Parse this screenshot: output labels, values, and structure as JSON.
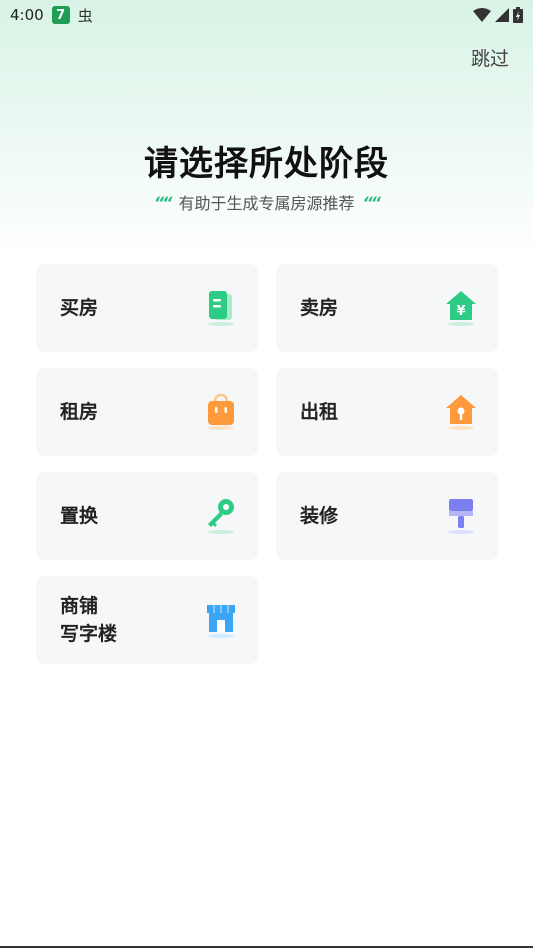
{
  "status_bar": {
    "time": "4:00",
    "app_badge": "7",
    "bug_glyph": "虫"
  },
  "header": {
    "skip_label": "跳过",
    "title": "请选择所处阶段",
    "subtitle": "有助于生成专属房源推荐",
    "quote_mark": "““"
  },
  "stages": [
    {
      "label": "买房",
      "icon": "document-icon",
      "color": "#2ecb86"
    },
    {
      "label": "卖房",
      "icon": "house-yuan-icon",
      "color": "#2ecb86"
    },
    {
      "label": "租房",
      "icon": "bag-icon",
      "color": "#ff9a3c"
    },
    {
      "label": "出租",
      "icon": "house-key-icon",
      "color": "#ff9a3c"
    },
    {
      "label": "置换",
      "icon": "key-icon",
      "color": "#2ecb86"
    },
    {
      "label": "装修",
      "icon": "paint-roller-icon",
      "color": "#7b7ff0"
    },
    {
      "label_line1": "商铺",
      "label_line2": "写字楼",
      "icon": "storefront-icon",
      "color": "#3aa6f5"
    }
  ]
}
